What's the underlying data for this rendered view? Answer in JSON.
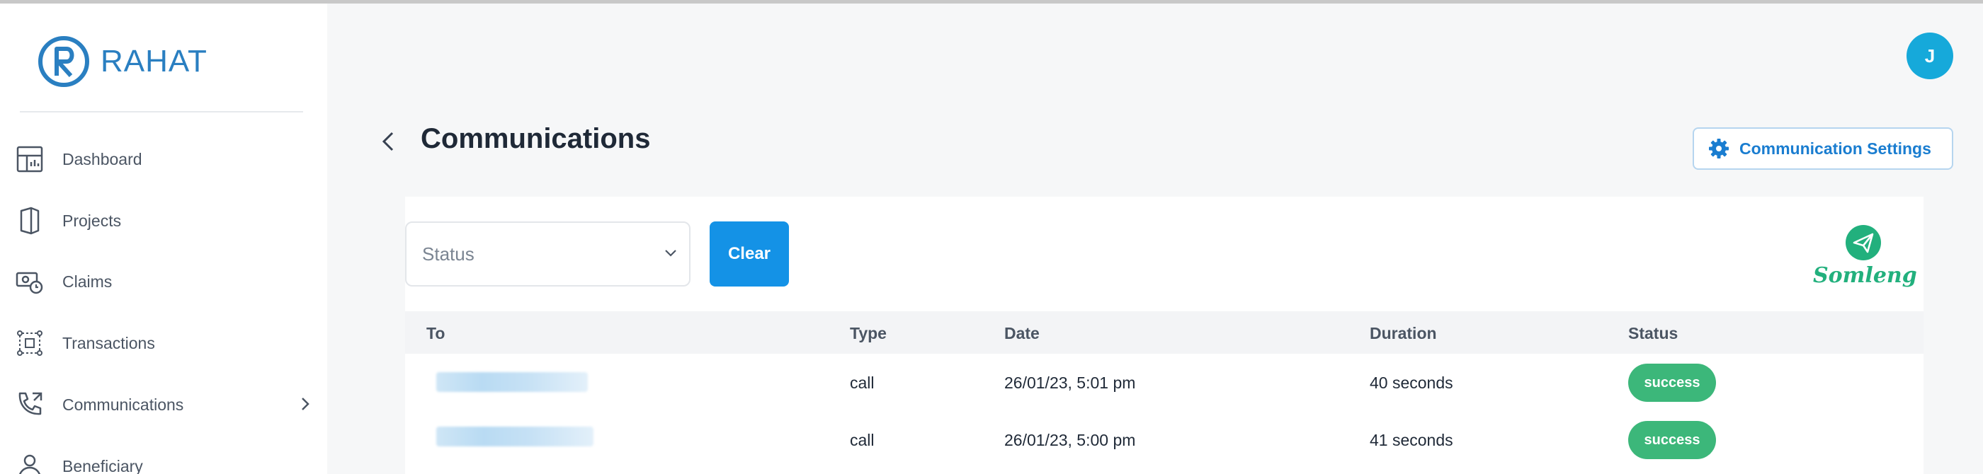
{
  "app": {
    "name": "RAHAT"
  },
  "user": {
    "avatar_initial": "J"
  },
  "sidebar": {
    "items": [
      {
        "label": "Dashboard",
        "icon": "dashboard-icon"
      },
      {
        "label": "Projects",
        "icon": "projects-icon"
      },
      {
        "label": "Claims",
        "icon": "claims-icon"
      },
      {
        "label": "Transactions",
        "icon": "transactions-icon"
      },
      {
        "label": "Communications",
        "icon": "phone-icon",
        "has_submenu": true
      },
      {
        "label": "Beneficiary",
        "icon": "beneficiary-icon"
      }
    ]
  },
  "page": {
    "title": "Communications",
    "settings_button": "Communication Settings"
  },
  "filters": {
    "status_placeholder": "Status",
    "clear_label": "Clear"
  },
  "provider": {
    "name": "Somleng"
  },
  "table": {
    "columns": [
      "To",
      "Type",
      "Date",
      "Duration",
      "Status"
    ],
    "rows": [
      {
        "to": "",
        "type": "call",
        "date": "26/01/23, 5:01 pm",
        "duration": "40 seconds",
        "status": "success"
      },
      {
        "to": "",
        "type": "call",
        "date": "26/01/23, 5:00 pm",
        "duration": "41 seconds",
        "status": "success"
      }
    ]
  },
  "colors": {
    "brand_blue": "#2a7fc1",
    "primary_button": "#1492e6",
    "avatar": "#16a9da",
    "success": "#3cb77a",
    "somleng_green": "#22b07d"
  }
}
